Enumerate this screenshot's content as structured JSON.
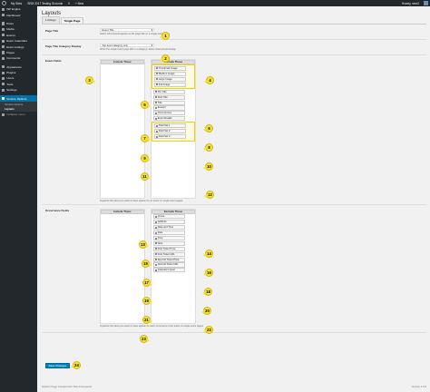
{
  "adminbar": {
    "site_label": "My Sites",
    "site_name": "SEM 2017 Testing Grounds",
    "comments": "0",
    "new_label": "+ New",
    "howdy": "Howdy, sem2"
  },
  "sidebar": {
    "items": [
      {
        "label": "WP Engine",
        "icon": "wpengine-icon"
      },
      {
        "label": "Dashboard",
        "icon": "dashboard-icon"
      },
      {
        "label": "Posts",
        "icon": "posts-icon"
      },
      {
        "label": "Media",
        "icon": "media-icon"
      },
      {
        "label": "Events",
        "icon": "events-icon"
      },
      {
        "label": "Event Calendars",
        "icon": "calendar-icon"
      },
      {
        "label": "Event Listings",
        "icon": "listings-icon"
      },
      {
        "label": "Pages",
        "icon": "pages-icon"
      },
      {
        "label": "Comments",
        "icon": "comments-icon"
      },
      {
        "label": "Appearance",
        "icon": "appearance-icon"
      },
      {
        "label": "Plugins",
        "icon": "plugins-icon"
      },
      {
        "label": "Users",
        "icon": "users-icon"
      },
      {
        "label": "Tools",
        "icon": "tools-icon"
      },
      {
        "label": "Settings",
        "icon": "settings-icon"
      }
    ],
    "active": {
      "label": "Venture Options",
      "icon": "venture-icon"
    },
    "subitems": [
      "Venture Options",
      "Layouts"
    ],
    "collapse": "Collapse menu"
  },
  "page": {
    "title": "Layouts",
    "tabs": [
      "Listings",
      "Single Page"
    ]
  },
  "fields": {
    "page_title": {
      "label": "Page Title",
      "value": "Event Title",
      "desc": "Select what should appear as the page title on a single event page."
    },
    "page_title_category": {
      "label": "Page Title Category Display",
      "value": "Top level category only",
      "desc": "When the single event page title is a category, select what should display."
    },
    "event_fields": {
      "label": "Event Fields",
      "include_head": "Include These",
      "exclude_head": "Exclude These",
      "exclude_items": [
        "Thumbnail Image",
        "Medium Image",
        "Large Image",
        "Full Image",
        "Pre Title",
        "Post Title",
        "Title",
        "Excerpt",
        "Occurrences",
        "Event Details",
        "Field Set 1",
        "Field Set 2",
        "Field Set 3"
      ],
      "desc": "Organize the items you want to have appear for an event on single event pages."
    },
    "occurrence_fields": {
      "label": "Occurrence Fields",
      "include_head": "Include These",
      "exclude_head": "Exclude These",
      "exclude_items": [
        "Venue",
        "Address",
        "Date and Time",
        "Date",
        "Time",
        "Note",
        "First Ticket Price",
        "First Ticket URL",
        "Second Ticket Price",
        "Second Ticket URL",
        "Calendar Import"
      ],
      "desc": "Organize the items you want to have appear for each occurrence of an event on single event pages."
    }
  },
  "save_label": "Save Changes",
  "footer": "Options Page Created with Titan Framework",
  "version": "Version 4.9.6",
  "callouts": [
    "1",
    "2",
    "3",
    "4",
    "5",
    "6",
    "7",
    "8",
    "9",
    "10",
    "11",
    "12",
    "13",
    "14",
    "15",
    "16",
    "17",
    "18",
    "19",
    "20",
    "21",
    "22",
    "23",
    "24"
  ],
  "colors": {
    "callout": "#f5e23a",
    "accent": "#0073aa",
    "button": "#0085ba"
  }
}
